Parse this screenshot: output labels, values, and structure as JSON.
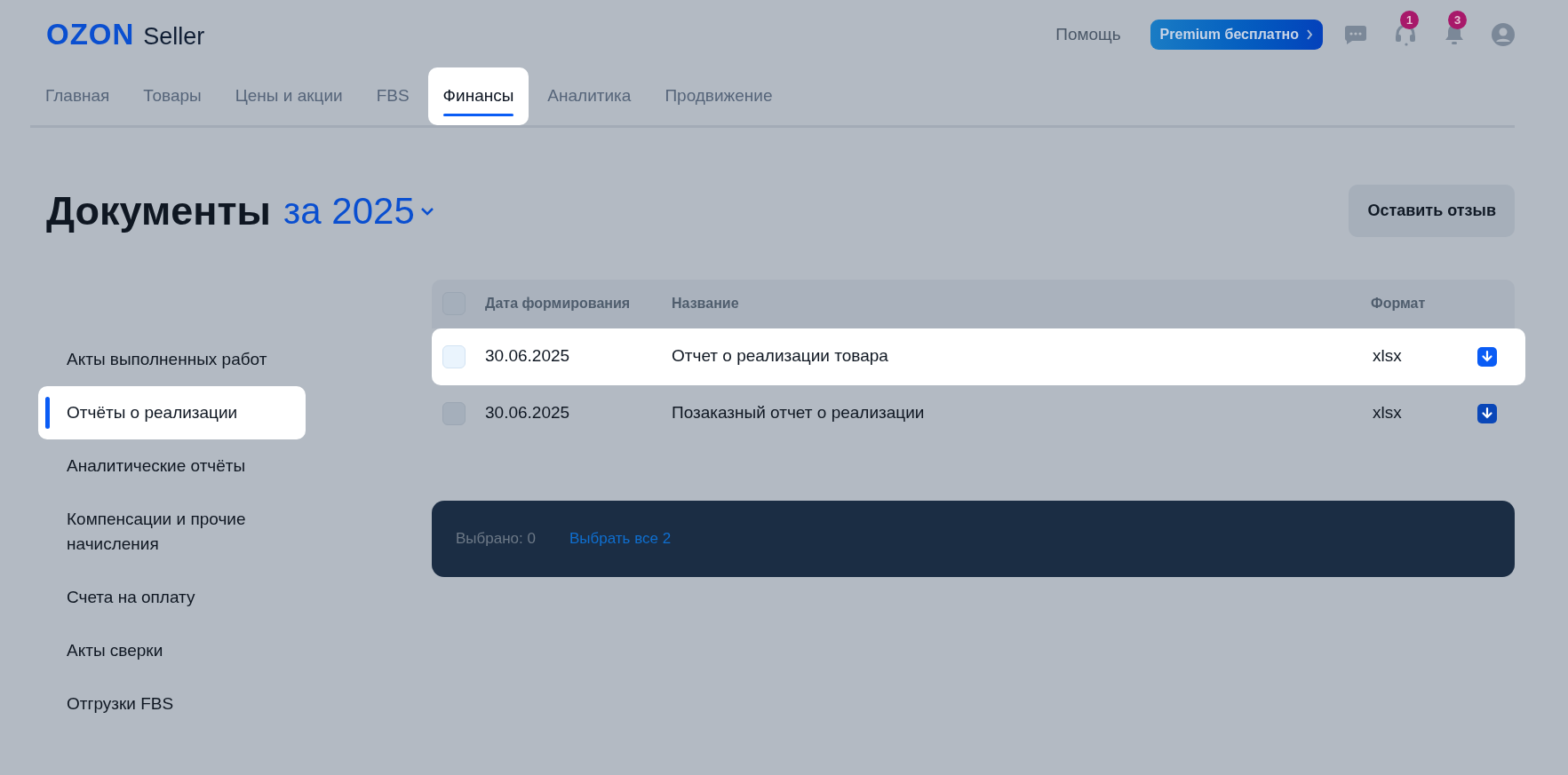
{
  "header": {
    "logo": "OZON",
    "product": "Seller",
    "help_link": "Помощь",
    "premium_button": "Premium бесплатно",
    "support_badge": "1",
    "notifications_badge": "3"
  },
  "tabs": [
    {
      "label": "Главная",
      "selected": false,
      "highlighted": false
    },
    {
      "label": "Товары",
      "selected": false,
      "highlighted": false
    },
    {
      "label": "Цены и акции",
      "selected": false,
      "highlighted": false
    },
    {
      "label": "FBS",
      "selected": false,
      "highlighted": false
    },
    {
      "label": "Финансы",
      "selected": true,
      "highlighted": true
    },
    {
      "label": "Аналитика",
      "selected": false,
      "highlighted": false
    },
    {
      "label": "Продвижение",
      "selected": false,
      "highlighted": false
    }
  ],
  "page": {
    "title": "Документы",
    "period": "за 2025",
    "feedback_button": "Оставить отзыв"
  },
  "sidebar": {
    "items": [
      {
        "label": "Акты выполненных работ",
        "selected": false,
        "highlighted": false
      },
      {
        "label": "Отчёты о реализации",
        "selected": true,
        "highlighted": true
      },
      {
        "label": "Аналитические отчёты",
        "selected": false,
        "highlighted": false
      },
      {
        "label": "Компенсации и прочие начисления",
        "selected": false,
        "highlighted": false
      },
      {
        "label": "Счета на оплату",
        "selected": false,
        "highlighted": false
      },
      {
        "label": "Акты сверки",
        "selected": false,
        "highlighted": false
      },
      {
        "label": "Отгрузки FBS",
        "selected": false,
        "highlighted": false
      }
    ]
  },
  "table": {
    "select_all_checked": false,
    "columns": [
      "Дата формирования",
      "Название",
      "Формат"
    ],
    "rows": [
      {
        "date": "30.06.2025",
        "name": "Отчет о реализации товара",
        "format": "xlsx",
        "checked": false,
        "highlighted": true
      },
      {
        "date": "30.06.2025",
        "name": "Позаказный отчет о реализации",
        "format": "xlsx",
        "checked": false,
        "highlighted": false
      }
    ]
  },
  "selection_bar": {
    "selected_label": "Выбрано:",
    "selected_count": "0",
    "select_all_link": "Выбрать все 2"
  }
}
